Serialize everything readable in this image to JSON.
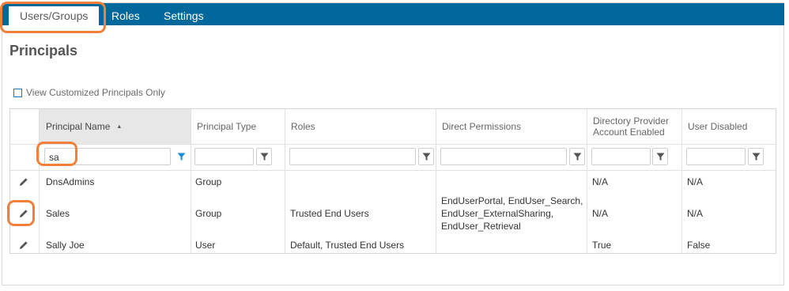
{
  "tabs": [
    {
      "label": "Users/Groups"
    },
    {
      "label": "Roles"
    },
    {
      "label": "Settings"
    }
  ],
  "page_title": "Principals",
  "filter_option": {
    "label": "View Customized Principals Only",
    "checked": false
  },
  "grid": {
    "columns": [
      {
        "label": "Principal Name",
        "sorted": "ascending"
      },
      {
        "label": "Principal Type"
      },
      {
        "label": "Roles"
      },
      {
        "label": "Direct Permissions"
      },
      {
        "label": "Directory Provider Account Enabled"
      },
      {
        "label": "User Disabled"
      }
    ],
    "filters": {
      "principal_name": "sa",
      "principal_type": "",
      "roles": "",
      "direct_permissions": "",
      "account_enabled": "",
      "user_disabled": ""
    },
    "rows": [
      {
        "name": "DnsAdmins",
        "type": "Group",
        "roles": "",
        "permissions": [
          "",
          "",
          ""
        ],
        "account_enabled": "N/A",
        "user_disabled": "N/A"
      },
      {
        "name": "Sales",
        "type": "Group",
        "roles": "Trusted End Users",
        "permissions": [
          "EndUserPortal, EndUser_Search,",
          "EndUser_ExternalSharing,",
          "EndUser_Retrieval"
        ],
        "account_enabled": "N/A",
        "user_disabled": "N/A"
      },
      {
        "name": "Sally Joe",
        "type": "User",
        "roles": "Default, Trusted End Users",
        "permissions": [
          "",
          "",
          ""
        ],
        "account_enabled": "True",
        "user_disabled": "False"
      }
    ]
  },
  "icons": {
    "edit": "pencil-icon",
    "filter": "funnel-icon",
    "sort": "sort-ascending-icon"
  },
  "colors": {
    "tab_bar": "#00689b",
    "highlight": "#f0803a",
    "filter_active": "#1a8ed6"
  }
}
